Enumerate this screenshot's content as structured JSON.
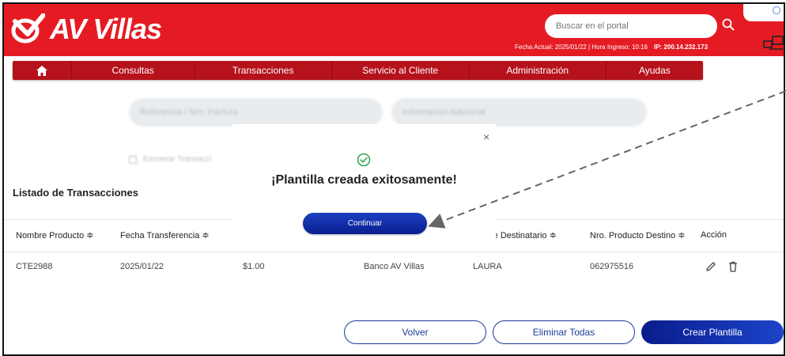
{
  "header": {
    "logo_text": "AV Villas",
    "search_placeholder": "Buscar en el portal",
    "meta_text": "Fecha Actual: 2025/01/22 | Hora Ingreso: 10:16",
    "ip_text": "IP: 200.14.232.173"
  },
  "nav": {
    "items": [
      "Consultas",
      "Transacciones",
      "Servicio al Cliente",
      "Administración",
      "Ayudas"
    ]
  },
  "filters": {
    "referencia_placeholder": "Referencia / Nro. Factura",
    "info_placeholder": "Informacion Adicional",
    "exonerar_label": "Exonerar Transacci"
  },
  "list": {
    "title": "Listado de Transacciones",
    "columns": [
      "Nombre Producto ≑",
      "Fecha Transferencia ≑",
      "re Destinatario ≑",
      "Nro. Producto Destino ≑",
      "Acción"
    ],
    "rows": [
      {
        "producto": "CTE2988",
        "fecha": "2025/01/22",
        "valor": "$1.00",
        "banco": "Banco AV Villas",
        "destinatario": "LAURA",
        "nro_destino": "062975516"
      }
    ]
  },
  "buttons": {
    "volver": "Volver",
    "eliminar": "Eliminar Todas",
    "crear": "Crear Plantilla"
  },
  "modal": {
    "close": "×",
    "title": "¡Plantilla creada exitosamente!",
    "button": "Continuar"
  },
  "colors": {
    "brand_red": "#e51b24",
    "nav_red": "#b5121b",
    "primary_blue": "#1b3a9b",
    "success_green": "#2aa84a"
  }
}
